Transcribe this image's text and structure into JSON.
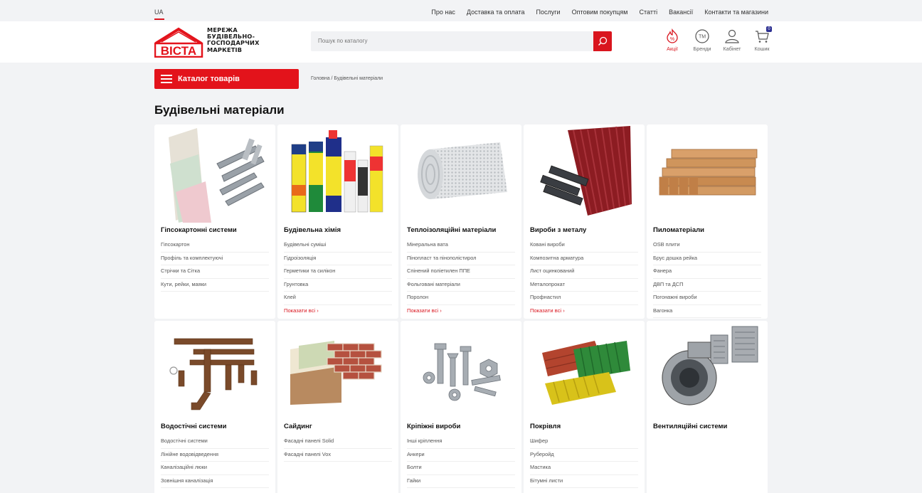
{
  "topbar": {
    "lang": "UA",
    "nav": [
      "Про нас",
      "Доставка та оплата",
      "Послуги",
      "Оптовим покупцям",
      "Статті",
      "Вакансії",
      "Контакти та магазини"
    ]
  },
  "header": {
    "logo_word": "ВІСТА",
    "logo_lines": [
      "МЕРЕЖА",
      "БУДІВЕЛЬНО-",
      "ГОСПОДАРЧИХ",
      "МАРКЕТІВ"
    ],
    "search_placeholder": "Пошук по каталогу",
    "icons": [
      {
        "label": "Акції",
        "icon": "promo-fire-icon"
      },
      {
        "label": "Бренди",
        "icon": "brand-tm-icon"
      },
      {
        "label": "Кабінет",
        "icon": "user-icon"
      },
      {
        "label": "Кошик",
        "icon": "cart-icon"
      }
    ],
    "cart_count": "0",
    "accent": "#d9151e"
  },
  "catalog_button": "Каталог товарів",
  "breadcrumb": "Головна / Будівельні матеріали",
  "page_title": "Будівельні матеріали",
  "categories": [
    {
      "title": "Гіпсокартонні системи",
      "links": [
        "Гіпсокартон",
        "Профіль та комплектуючі",
        "Стрічки та Сітка",
        "Кути, рейки, маяки"
      ],
      "show_all": ""
    },
    {
      "title": "Будівельна хімія",
      "links": [
        "Будівельні суміші",
        "Гідроізоляція",
        "Герметики та силікон",
        "Грунтовка",
        "Клей"
      ],
      "show_all": "Показати всі"
    },
    {
      "title": "Теплоізоляційні матеріали",
      "links": [
        "Мінеральна вата",
        "Пінопласт та пінополістирол",
        "Спінений поліетилен ППЕ",
        "Фольговані матеріали",
        "Поролон"
      ],
      "show_all": "Показати всі"
    },
    {
      "title": "Вироби з металу",
      "links": [
        "Ковані вироби",
        "Композитна арматура",
        "Лист оцинкований",
        "Металопрокат",
        "Профнастил"
      ],
      "show_all": "Показати всі"
    },
    {
      "title": "Пиломатеріали",
      "links": [
        "OSB плити",
        "Брус дошка рейка",
        "Фанера",
        "ДВП та ДСП",
        "Погонажні вироби",
        "Вагонка"
      ],
      "show_all": ""
    },
    {
      "title": "Водостічні системи",
      "links": [
        "Водостічні системи",
        "Лінійне водовідведення",
        "Каналізаційні люки",
        "Зовнішня каналізація"
      ],
      "show_all": ""
    },
    {
      "title": "Сайдинг",
      "links": [
        "Фасадні панелі Solid",
        "Фасадні панелі Vox"
      ],
      "show_all": ""
    },
    {
      "title": "Кріпіжні вироби",
      "links": [
        "Інші кріплення",
        "Анкери",
        "Болти",
        "Гайки"
      ],
      "show_all": ""
    },
    {
      "title": "Покрівля",
      "links": [
        "Шифер",
        "Руберойд",
        "Мастика",
        "Бітумні листи"
      ],
      "show_all": ""
    },
    {
      "title": "Вентиляційні системи",
      "links": [],
      "show_all": ""
    }
  ]
}
